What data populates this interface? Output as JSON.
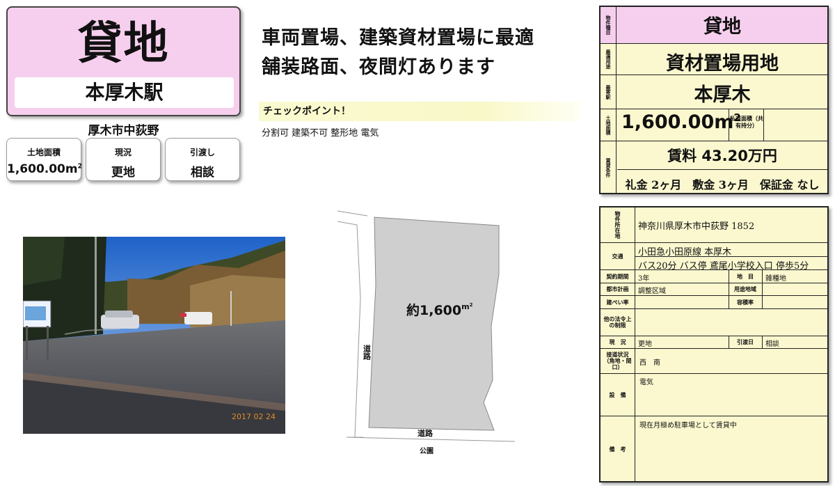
{
  "title_card": {
    "title": "貸地",
    "station": "本厚木駅",
    "location": "厚木市中荻野"
  },
  "info_boxes": [
    {
      "label": "土地面積",
      "value": "1,600.00",
      "unit": "m2"
    },
    {
      "label": "現況",
      "value": "更地"
    },
    {
      "label": "引渡し",
      "value": "相談"
    }
  ],
  "headline": {
    "line1": "車両置場、建築資材置場に最適",
    "line2": "舗装路面、夜間灯あります"
  },
  "checkpoint": {
    "title": "チェックポイント！",
    "detail": "分割可 建築不可 整形地 電気"
  },
  "photo": {
    "sign_text": "専用駐車場",
    "date_stamp": "2017 02 24"
  },
  "plot": {
    "area_label": "約1,600",
    "area_unit": "m2",
    "road_left": "道路",
    "road_bottom": "道路",
    "park": "公園"
  },
  "spec": {
    "type_label": "物件種目",
    "type": "貸地",
    "use_label": "最適用途",
    "use": "資材置場用地",
    "station_label": "最寄駅",
    "station": "本厚木",
    "area_label": "土地面積",
    "area": "1,600.00",
    "area_unit": "m2",
    "private_road_label": "私道面積（共有持分）",
    "rent_label": "賃貸条件",
    "rent": "賃料 43.20万円",
    "conditions": "礼金 2ヶ月　敷金 3ヶ月　保証金 なし"
  },
  "detail": {
    "address_label": "物件所在地",
    "address": "神奈川県厚木市中荻野 1852",
    "transport_label": "交通",
    "transport1": "小田急小田原線 本厚木",
    "transport2": "バス20分 バス停 鳶尾小学校入口 停歩5分",
    "contract_label": "契約期間",
    "contract": "3年",
    "land_label": "地　目",
    "land": "雑種地",
    "planning_label": "都市計画",
    "planning": "調整区域",
    "zoning_label": "用途地域",
    "zoning": "",
    "bcr_label": "建ぺい率",
    "bcr": "",
    "far_label": "容積率",
    "far": "",
    "legal_label": "他の法令上の制限",
    "legal": "",
    "status_label": "現　況",
    "status": "更地",
    "handover_label": "引渡日",
    "handover": "相談",
    "road_label": "接道状況（角地・間口）",
    "road": "西　南",
    "facilities_label": "設　備",
    "facilities": "電気",
    "notes_label": "備　考",
    "notes": "現在月極め駐車場として賃貸中"
  }
}
